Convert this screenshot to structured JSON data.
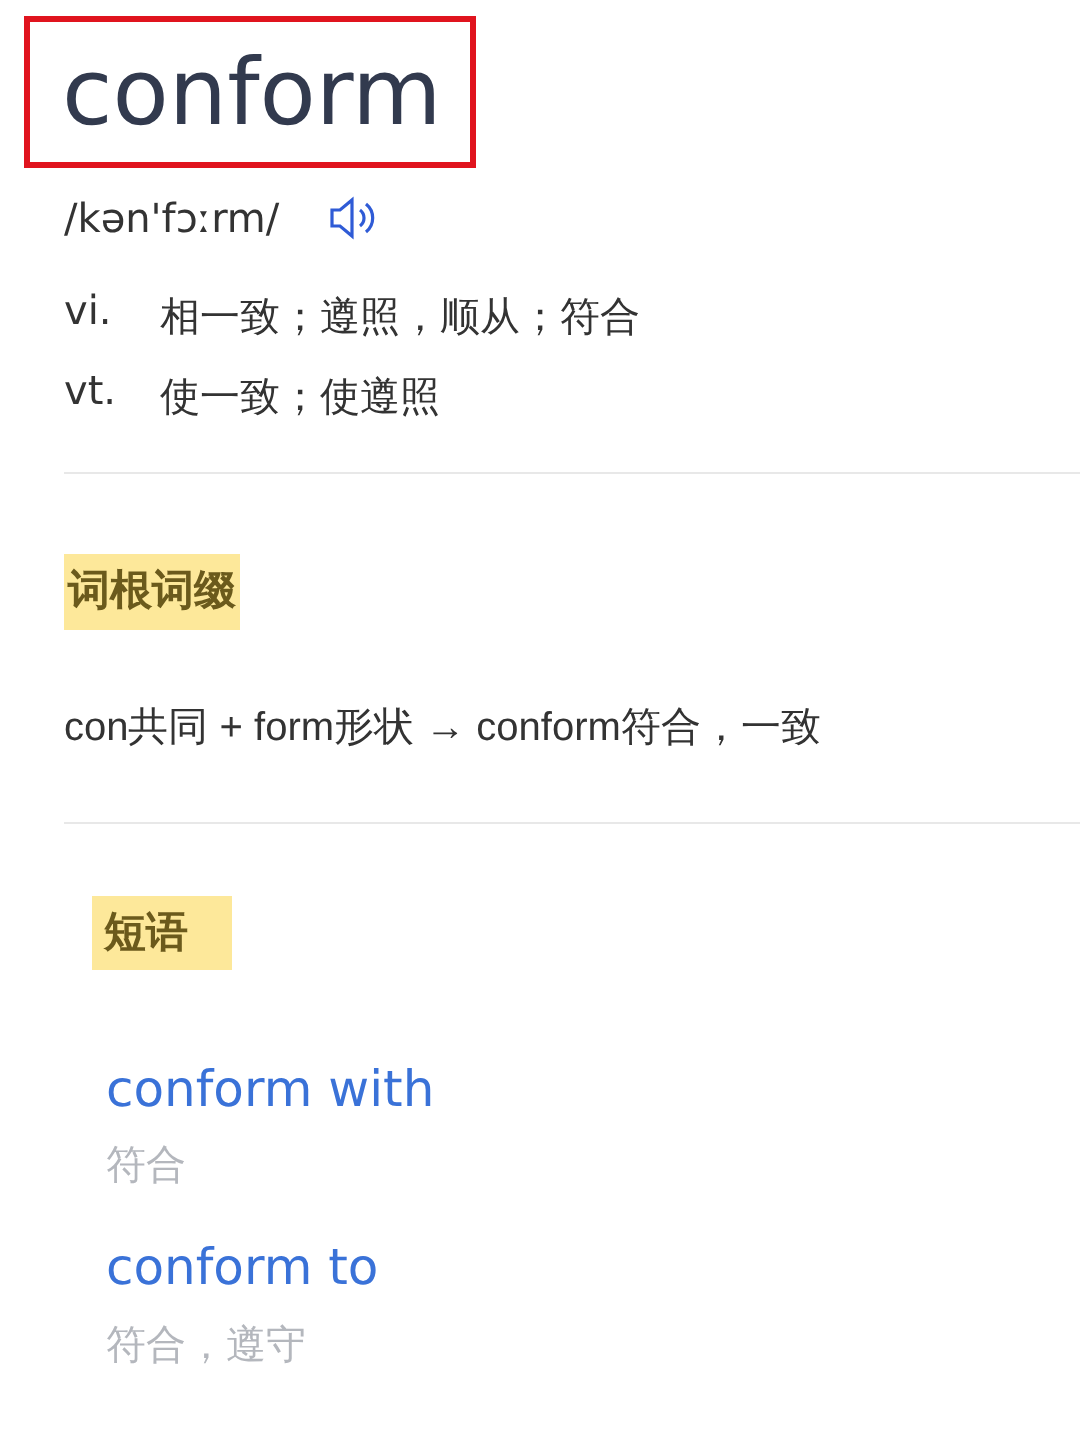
{
  "headword": {
    "text": "conform",
    "boxed": true
  },
  "phonetic": "/kən'fɔːrm/",
  "senses": [
    {
      "pos": "vi.",
      "meaning": "相一致；遵照，顺从；符合"
    },
    {
      "pos": "vt.",
      "meaning": "使一致；使遵照"
    }
  ],
  "roots": {
    "heading": "词根词缀",
    "text": "con共同 + form形状 → conform符合，一致"
  },
  "phrases": {
    "heading": "短语",
    "items": [
      {
        "phrase": "conform with",
        "meaning": "符合"
      },
      {
        "phrase": "conform to",
        "meaning": "符合，遵守"
      }
    ]
  }
}
